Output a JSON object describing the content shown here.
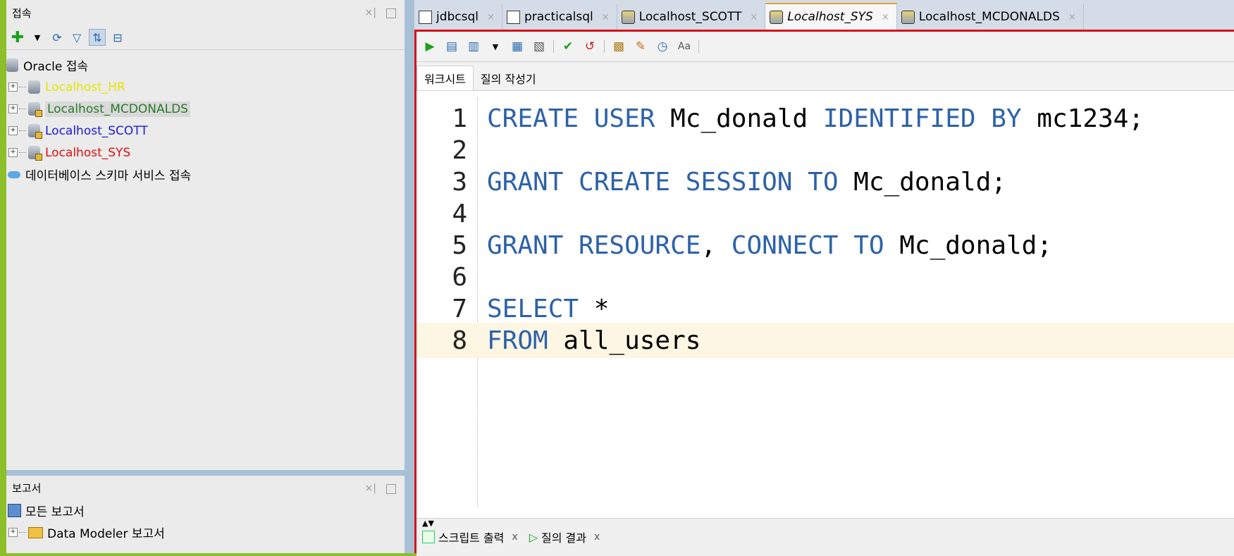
{
  "connections_panel": {
    "title": "접속",
    "tree_root": "Oracle 접속",
    "connections": [
      {
        "label": "Localhost_HR",
        "color": "#e6e600",
        "highlight": false
      },
      {
        "label": "Localhost_MCDONALDS",
        "color": "#2a7a2a",
        "highlight": true
      },
      {
        "label": "Localhost_SCOTT",
        "color": "#1a1adc",
        "highlight": false
      },
      {
        "label": "Localhost_SYS",
        "color": "#e01010",
        "highlight": false
      }
    ],
    "cloud_item": "데이터베이스 스키마 서비스 접속"
  },
  "reports_panel": {
    "title": "보고서",
    "items": [
      "모든 보고서",
      "Data Modeler 보고서"
    ]
  },
  "editor_tabs": [
    {
      "label": "jdbcsql",
      "active": false
    },
    {
      "label": "practicalsql",
      "active": false
    },
    {
      "label": "Localhost_SCOTT",
      "active": false
    },
    {
      "label": "Localhost_SYS",
      "active": true
    },
    {
      "label": "Localhost_MCDONALDS",
      "active": false
    }
  ],
  "sub_tabs": [
    "워크시트",
    "질의 작성기"
  ],
  "code_lines": [
    {
      "n": "1",
      "parts": [
        [
          "kw",
          "CREATE USER"
        ],
        [
          "t",
          " Mc_donald "
        ],
        [
          "kw",
          "IDENTIFIED BY"
        ],
        [
          "t",
          " mc1234;"
        ]
      ]
    },
    {
      "n": "2",
      "parts": []
    },
    {
      "n": "3",
      "parts": [
        [
          "kw",
          "GRANT CREATE SESSION TO"
        ],
        [
          "t",
          " Mc_donald;"
        ]
      ]
    },
    {
      "n": "4",
      "parts": []
    },
    {
      "n": "5",
      "parts": [
        [
          "kw",
          "GRANT RESOURCE"
        ],
        [
          "t",
          ", "
        ],
        [
          "kw",
          "CONNECT TO"
        ],
        [
          "t",
          " Mc_donald;"
        ]
      ]
    },
    {
      "n": "6",
      "parts": []
    },
    {
      "n": "7",
      "parts": [
        [
          "kw",
          "SELECT"
        ],
        [
          "t",
          " *"
        ]
      ]
    },
    {
      "n": "8",
      "parts": [
        [
          "kw",
          "FROM"
        ],
        [
          "t",
          " all_users"
        ]
      ]
    }
  ],
  "current_line": "8",
  "output_tabs": [
    "스크립트 출력",
    "질의 결과"
  ],
  "close_glyph": "x"
}
